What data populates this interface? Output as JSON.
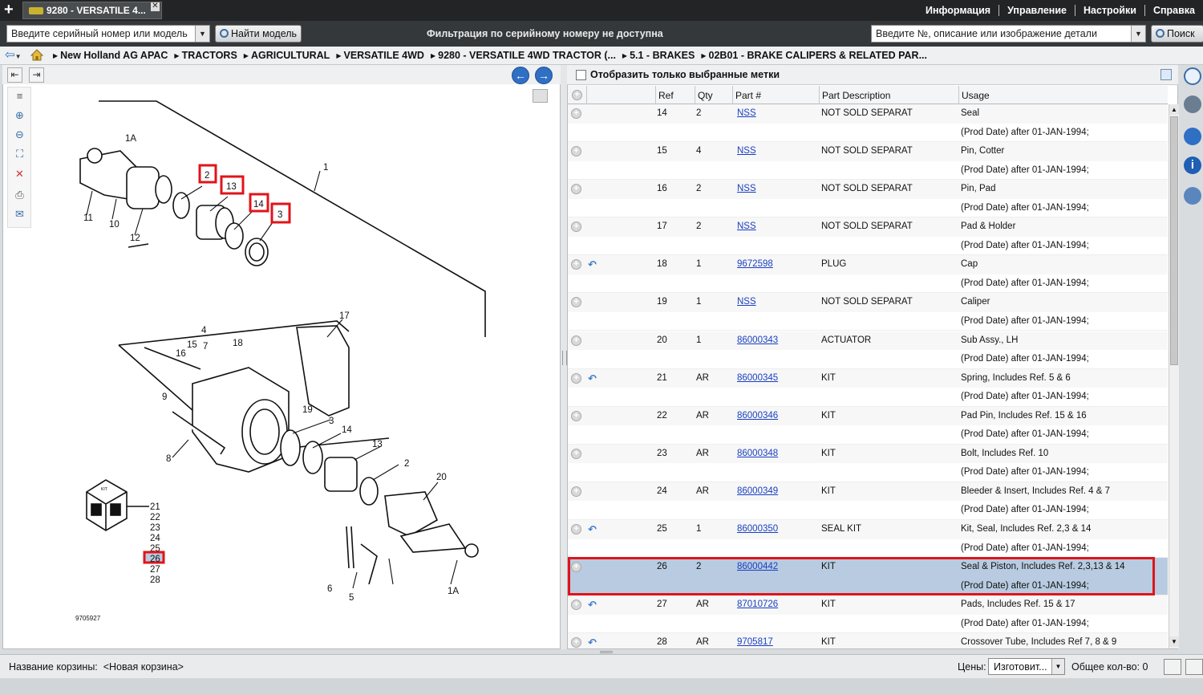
{
  "tab": {
    "title": "9280 - VERSATILE 4..."
  },
  "menu": {
    "info": "Информация",
    "manage": "Управление",
    "settings": "Настройки",
    "help": "Справка"
  },
  "search": {
    "serial_placeholder": "Введите серийный номер или модель",
    "find_model": "Найти модель",
    "filter_status": "Фильтрация по серийному номеру не доступна",
    "part_placeholder": "Введите №, описание или изображение детали",
    "search_btn": "Поиск"
  },
  "breadcrumb": [
    "New Holland AG APAC",
    "TRACTORS",
    "AGRICULTURAL",
    "VERSATILE 4WD",
    "9280 - VERSATILE 4WD TRACTOR (...",
    "5.1 - BRAKES",
    "02B01 - BRAKE CALIPERS & RELATED PAR..."
  ],
  "filter": {
    "label": "Отобразить только выбранные метки"
  },
  "table": {
    "headers": [
      "Ref",
      "Qty",
      "Part #",
      "Part Description",
      "Usage"
    ],
    "rows": [
      {
        "ref": "14",
        "qty": "2",
        "part": "NSS",
        "desc": "NOT SOLD SEPARAT",
        "usage": "Seal",
        "date": "(Prod Date) after 01-JAN-1994;",
        "swap": false
      },
      {
        "ref": "15",
        "qty": "4",
        "part": "NSS",
        "desc": "NOT SOLD SEPARAT",
        "usage": "Pin, Cotter",
        "date": "(Prod Date) after 01-JAN-1994;",
        "swap": false
      },
      {
        "ref": "16",
        "qty": "2",
        "part": "NSS",
        "desc": "NOT SOLD SEPARAT",
        "usage": "Pin, Pad",
        "date": "(Prod Date) after 01-JAN-1994;",
        "swap": false
      },
      {
        "ref": "17",
        "qty": "2",
        "part": "NSS",
        "desc": "NOT SOLD SEPARAT",
        "usage": "Pad & Holder",
        "date": "(Prod Date) after 01-JAN-1994;",
        "swap": false
      },
      {
        "ref": "18",
        "qty": "1",
        "part": "9672598",
        "desc": "PLUG",
        "usage": "Cap",
        "date": "(Prod Date) after 01-JAN-1994;",
        "swap": true
      },
      {
        "ref": "19",
        "qty": "1",
        "part": "NSS",
        "desc": "NOT SOLD SEPARAT",
        "usage": "Caliper",
        "date": "(Prod Date) after 01-JAN-1994;",
        "swap": false
      },
      {
        "ref": "20",
        "qty": "1",
        "part": "86000343",
        "desc": "ACTUATOR",
        "usage": "Sub Assy., LH",
        "date": "(Prod Date) after 01-JAN-1994;",
        "swap": false
      },
      {
        "ref": "21",
        "qty": "AR",
        "part": "86000345",
        "desc": "KIT",
        "usage": "Spring, Includes Ref. 5 & 6",
        "date": "(Prod Date) after 01-JAN-1994;",
        "swap": true
      },
      {
        "ref": "22",
        "qty": "AR",
        "part": "86000346",
        "desc": "KIT",
        "usage": "Pad Pin, Includes Ref. 15 & 16",
        "date": "(Prod Date) after 01-JAN-1994;",
        "swap": false
      },
      {
        "ref": "23",
        "qty": "AR",
        "part": "86000348",
        "desc": "KIT",
        "usage": "Bolt, Includes Ref. 10",
        "date": "(Prod Date) after 01-JAN-1994;",
        "swap": false
      },
      {
        "ref": "24",
        "qty": "AR",
        "part": "86000349",
        "desc": "KIT",
        "usage": "Bleeder & Insert, Includes Ref. 4 & 7",
        "date": "(Prod Date) after 01-JAN-1994;",
        "swap": false
      },
      {
        "ref": "25",
        "qty": "1",
        "part": "86000350",
        "desc": "SEAL KIT",
        "usage": "Kit, Seal, Includes Ref. 2,3 & 14",
        "date": "(Prod Date) after 01-JAN-1994;",
        "swap": true
      },
      {
        "ref": "26",
        "qty": "2",
        "part": "86000442",
        "desc": "KIT",
        "usage": "Seal & Piston, Includes Ref. 2,3,13 & 14",
        "date": "(Prod Date) after 01-JAN-1994;",
        "swap": false,
        "selected": true
      },
      {
        "ref": "27",
        "qty": "AR",
        "part": "87010726",
        "desc": "KIT",
        "usage": "Pads, Includes Ref. 15 & 17",
        "date": "(Prod Date) after 01-JAN-1994;",
        "swap": true
      },
      {
        "ref": "28",
        "qty": "AR",
        "part": "9705817",
        "desc": "KIT",
        "usage": "Crossover Tube, Includes Ref 7, 8 & 9",
        "date": "",
        "swap": true
      }
    ]
  },
  "diagram": {
    "callouts": [
      "1A",
      "11",
      "10",
      "12",
      "2",
      "13",
      "14",
      "3",
      "1",
      "17",
      "4",
      "15",
      "16",
      "7",
      "18",
      "9",
      "19",
      "8",
      "5",
      "6",
      "20",
      "1A",
      "KIT"
    ],
    "kit_refs": [
      "21",
      "22",
      "23",
      "24",
      "25",
      "26",
      "27",
      "28"
    ],
    "drawing_id": "9705927"
  },
  "footer": {
    "basket_label": "Название корзины:",
    "basket_value": "<Новая корзина>",
    "price_label": "Цены:",
    "price_value": "Изготовит...",
    "qty_label": "Общее кол-во: 0"
  },
  "colors": {
    "highlight": "#e0141a",
    "selected_row": "#b8cbe0",
    "link": "#1a3fc0"
  }
}
